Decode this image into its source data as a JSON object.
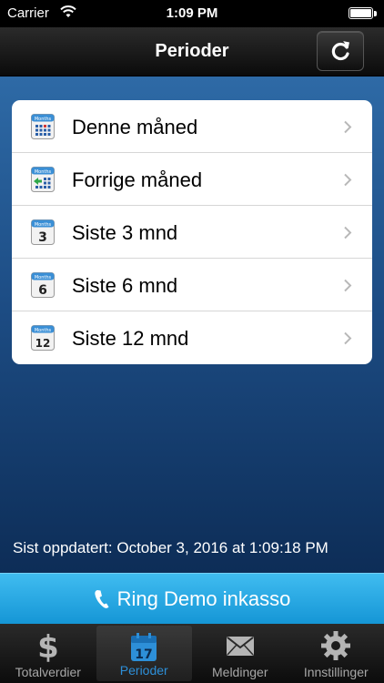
{
  "status_bar": {
    "carrier": "Carrier",
    "time": "1:09 PM"
  },
  "nav": {
    "title": "Perioder",
    "refresh_icon": "refresh-icon"
  },
  "periods": {
    "items": [
      {
        "label": "Denne måned",
        "icon": "calendar-grid-icon"
      },
      {
        "label": "Forrige måned",
        "icon": "calendar-back-icon"
      },
      {
        "label": "Siste 3 mnd",
        "icon": "calendar-3-icon",
        "badge": "3"
      },
      {
        "label": "Siste 6 mnd",
        "icon": "calendar-6-icon",
        "badge": "6"
      },
      {
        "label": "Siste 12 mnd",
        "icon": "calendar-12-icon",
        "badge": "12"
      }
    ],
    "calendar_header": "Months"
  },
  "last_updated": "Sist oppdatert: October 3, 2016 at 1:09:18 PM",
  "call": {
    "label": "Ring Demo inkasso"
  },
  "tabs": [
    {
      "label": "Totalverdier",
      "icon": "dollar-icon",
      "active": false
    },
    {
      "label": "Perioder",
      "icon": "calendar-icon",
      "active": true
    },
    {
      "label": "Meldinger",
      "icon": "envelope-icon",
      "active": false
    },
    {
      "label": "Innstillinger",
      "icon": "gear-icon",
      "active": false
    }
  ],
  "tab_calendar_day": "17",
  "colors": {
    "accent": "#2d8fd8",
    "call_bar": "#1fa7e3",
    "content_top": "#2e6aa6",
    "content_bottom": "#0d2d57"
  }
}
